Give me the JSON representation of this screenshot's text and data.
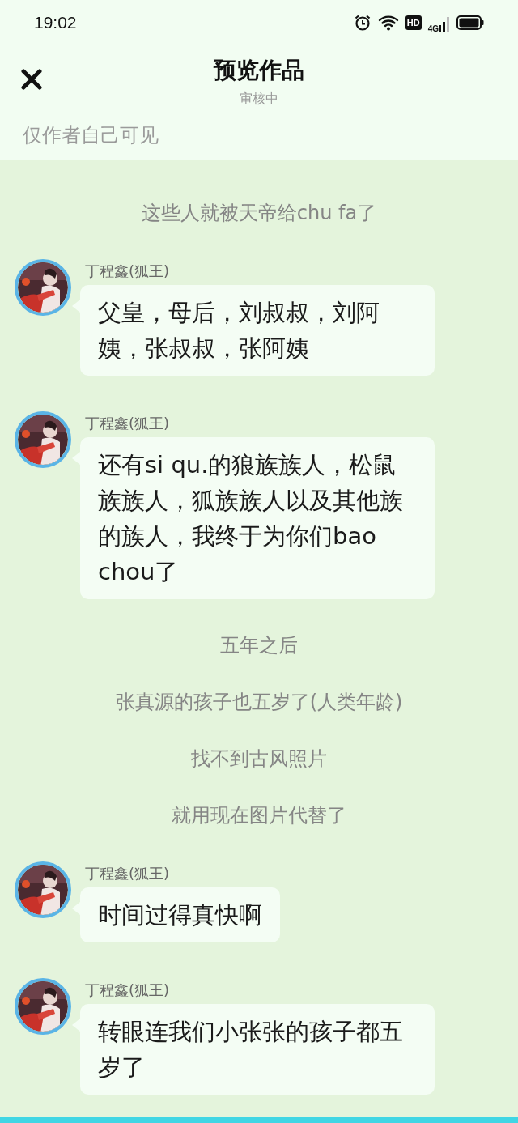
{
  "status_bar": {
    "time": "19:02",
    "hd_label": "HD",
    "network_label": "4G"
  },
  "header": {
    "title": "预览作品",
    "subtitle": "审核中"
  },
  "notice": "仅作者自己可见",
  "chat": [
    {
      "kind": "note",
      "text": "这些人就被天帝给chu fa了"
    },
    {
      "kind": "message",
      "sender": "丁程鑫(狐王)",
      "text": "父皇，母后，刘叔叔，刘阿姨，张叔叔，张阿姨"
    },
    {
      "kind": "message",
      "sender": "丁程鑫(狐王)",
      "text": "还有si qu.的狼族族人，松鼠族族人，狐族族人以及其他族的族人，我终于为你们bao chou了"
    },
    {
      "kind": "note",
      "text": "五年之后"
    },
    {
      "kind": "note",
      "text": "张真源的孩子也五岁了(人类年龄)"
    },
    {
      "kind": "note",
      "text": "找不到古风照片"
    },
    {
      "kind": "note",
      "text": "就用现在图片代替了"
    },
    {
      "kind": "message",
      "sender": "丁程鑫(狐王)",
      "text": "时间过得真快啊"
    },
    {
      "kind": "message",
      "sender": "丁程鑫(狐王)",
      "text": "转眼连我们小张张的孩子都五岁了"
    }
  ]
}
